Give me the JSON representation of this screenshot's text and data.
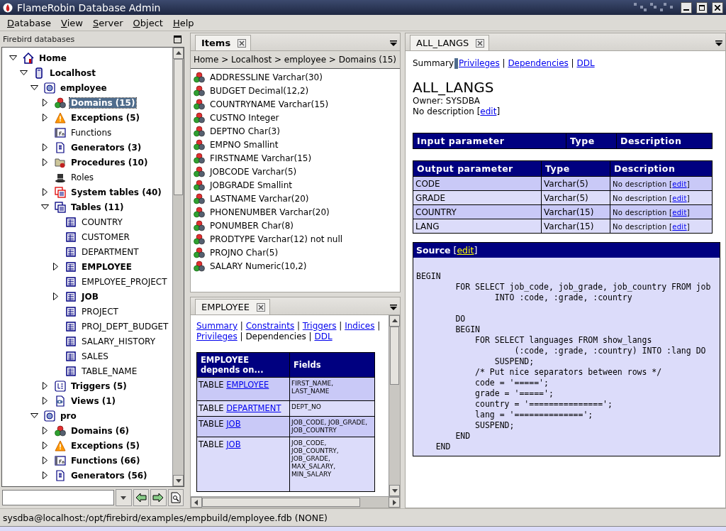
{
  "window": {
    "title": "FlameRobin Database Admin"
  },
  "menu": [
    {
      "label": "Database"
    },
    {
      "label": "View"
    },
    {
      "label": "Server"
    },
    {
      "label": "Object"
    },
    {
      "label": "Help"
    }
  ],
  "tree": {
    "title": "Firebird databases",
    "items": [
      {
        "label": "Home",
        "kind": "home",
        "expandable": true,
        "expanded": true,
        "selected": false,
        "children": [
          {
            "label": "Localhost",
            "kind": "server",
            "expandable": true,
            "expanded": true,
            "selected": false,
            "children": [
              {
                "label": "employee",
                "kind": "database",
                "expandable": true,
                "expanded": true,
                "selected": false,
                "children": [
                  {
                    "label": "Domains (15)",
                    "kind": "domains",
                    "expandable": true,
                    "expanded": false,
                    "selected": true
                  },
                  {
                    "label": "Exceptions (5)",
                    "kind": "exceptions",
                    "expandable": true,
                    "expanded": false,
                    "selected": false
                  },
                  {
                    "label": "Functions",
                    "kind": "functions",
                    "expandable": false,
                    "selected": false
                  },
                  {
                    "label": "Generators (3)",
                    "kind": "generators",
                    "expandable": true,
                    "expanded": false,
                    "selected": false
                  },
                  {
                    "label": "Procedures (10)",
                    "kind": "procedures",
                    "expandable": true,
                    "expanded": false,
                    "selected": false
                  },
                  {
                    "label": "Roles",
                    "kind": "roles",
                    "expandable": false,
                    "selected": false
                  },
                  {
                    "label": "System tables (40)",
                    "kind": "systables",
                    "expandable": true,
                    "expanded": false,
                    "selected": false
                  },
                  {
                    "label": "Tables (11)",
                    "kind": "tables",
                    "expandable": true,
                    "expanded": true,
                    "selected": false,
                    "children": [
                      {
                        "label": "COUNTRY",
                        "kind": "table",
                        "expandable": false,
                        "selected": false
                      },
                      {
                        "label": "CUSTOMER",
                        "kind": "table",
                        "expandable": false,
                        "selected": false
                      },
                      {
                        "label": "DEPARTMENT",
                        "kind": "table",
                        "expandable": false,
                        "selected": false
                      },
                      {
                        "label": "EMPLOYEE",
                        "kind": "table",
                        "expandable": true,
                        "expanded": false,
                        "selected": false
                      },
                      {
                        "label": "EMPLOYEE_PROJECT",
                        "kind": "table",
                        "expandable": false,
                        "selected": false
                      },
                      {
                        "label": "JOB",
                        "kind": "table",
                        "expandable": true,
                        "expanded": false,
                        "selected": false
                      },
                      {
                        "label": "PROJECT",
                        "kind": "table",
                        "expandable": false,
                        "selected": false
                      },
                      {
                        "label": "PROJ_DEPT_BUDGET",
                        "kind": "table",
                        "expandable": false,
                        "selected": false
                      },
                      {
                        "label": "SALARY_HISTORY",
                        "kind": "table",
                        "expandable": false,
                        "selected": false
                      },
                      {
                        "label": "SALES",
                        "kind": "table",
                        "expandable": false,
                        "selected": false
                      },
                      {
                        "label": "TABLE_NAME",
                        "kind": "table",
                        "expandable": false,
                        "selected": false
                      }
                    ]
                  },
                  {
                    "label": "Triggers (5)",
                    "kind": "triggers",
                    "expandable": true,
                    "expanded": false,
                    "selected": false
                  },
                  {
                    "label": "Views (1)",
                    "kind": "views",
                    "expandable": true,
                    "expanded": false,
                    "selected": false
                  }
                ]
              },
              {
                "label": "pro",
                "kind": "database",
                "expandable": true,
                "expanded": true,
                "selected": false,
                "children": [
                  {
                    "label": "Domains (6)",
                    "kind": "domains",
                    "expandable": true,
                    "expanded": false,
                    "selected": false
                  },
                  {
                    "label": "Exceptions (5)",
                    "kind": "exceptions",
                    "expandable": true,
                    "expanded": false,
                    "selected": false
                  },
                  {
                    "label": "Functions (66)",
                    "kind": "functions",
                    "expandable": true,
                    "expanded": false,
                    "selected": false
                  },
                  {
                    "label": "Generators (56)",
                    "kind": "generators",
                    "expandable": true,
                    "expanded": false,
                    "selected": false
                  }
                ]
              }
            ]
          }
        ]
      }
    ]
  },
  "items_panel": {
    "tab": "Items",
    "breadcrumb": "Home > Localhost > employee > Domains (15)",
    "items": [
      "ADDRESSLINE Varchar(30)",
      "BUDGET Decimal(12,2)",
      "COUNTRYNAME Varchar(15)",
      "CUSTNO Integer",
      "DEPTNO Char(3)",
      "EMPNO Smallint",
      "FIRSTNAME Varchar(15)",
      "JOBCODE Varchar(5)",
      "JOBGRADE Smallint",
      "LASTNAME Varchar(20)",
      "PHONENUMBER Varchar(20)",
      "PONUMBER Char(8)",
      "PRODTYPE Varchar(12) not null",
      "PROJNO Char(5)",
      "SALARY Numeric(10,2)"
    ]
  },
  "object_panel": {
    "tab": "EMPLOYEE",
    "links": [
      {
        "label": "Summary",
        "current": false
      },
      {
        "label": "Constraints",
        "current": false
      },
      {
        "label": "Triggers",
        "current": false
      },
      {
        "label": "Indices",
        "current": false
      },
      {
        "label": "Privileges",
        "current": false
      },
      {
        "label": "Dependencies",
        "current": true
      },
      {
        "label": "DDL",
        "current": false
      }
    ],
    "separator": "|",
    "table": {
      "columns": [
        "EMPLOYEE depends on...",
        "Fields"
      ],
      "rows": [
        {
          "prefix": "TABLE",
          "link": "EMPLOYEE",
          "fields": "FIRST_NAME, LAST_NAME"
        },
        {
          "prefix": "TABLE",
          "link": "DEPARTMENT",
          "fields": "DEPT_NO"
        },
        {
          "prefix": "TABLE",
          "link": "JOB",
          "fields": "JOB_CODE, JOB_GRADE, JOB_COUNTRY"
        },
        {
          "prefix": "TABLE",
          "link": "JOB",
          "fields": "JOB_CODE, JOB_COUNTRY, JOB_GRADE, MAX_SALARY, MIN_SALARY"
        }
      ]
    }
  },
  "detail_panel": {
    "tab": "ALL_LANGS",
    "links": [
      {
        "label": "Summary",
        "current": true
      },
      {
        "label": "Privileges",
        "current": false
      },
      {
        "label": "Dependencies",
        "current": false
      },
      {
        "label": "DDL",
        "current": false
      }
    ],
    "separator": "|",
    "title": "ALL_LANGS",
    "owner": "Owner: SYSDBA",
    "description": {
      "before": "No description [",
      "link": "edit",
      "after": "]"
    },
    "input_table": {
      "columns": [
        "Input parameter",
        "Type",
        "Description"
      ]
    },
    "output_table": {
      "columns": [
        "Output parameter",
        "Type",
        "Description"
      ],
      "rows": [
        {
          "name": "CODE",
          "type": "Varchar(5)",
          "before": "No description [",
          "link": "edit",
          "after": "]"
        },
        {
          "name": "GRADE",
          "type": "Varchar(5)",
          "before": "No description [",
          "link": "edit",
          "after": "]"
        },
        {
          "name": "COUNTRY",
          "type": "Varchar(15)",
          "before": "No description [",
          "link": "edit",
          "after": "]"
        },
        {
          "name": "LANG",
          "type": "Varchar(15)",
          "before": "No description [",
          "link": "edit",
          "after": "]"
        }
      ]
    },
    "source": {
      "title": "Source",
      "before": "[",
      "link": "edit",
      "after": "]",
      "code": "BEGIN\n        FOR SELECT job_code, job_grade, job_country FROM job\n                INTO :code, :grade, :country\n\n        DO\n        BEGIN\n            FOR SELECT languages FROM show_langs\n                    (:code, :grade, :country) INTO :lang DO\n                SUSPEND;\n            /* Put nice separators between rows */\n            code = '=====';\n            grade = '=====';\n            country = '===============';\n            lang = '==============';\n            SUSPEND;\n        END\n    END"
    }
  },
  "status_bar": "sysdba@localhost:/opt/firebird/examples/empbuild/employee.fdb (NONE)"
}
